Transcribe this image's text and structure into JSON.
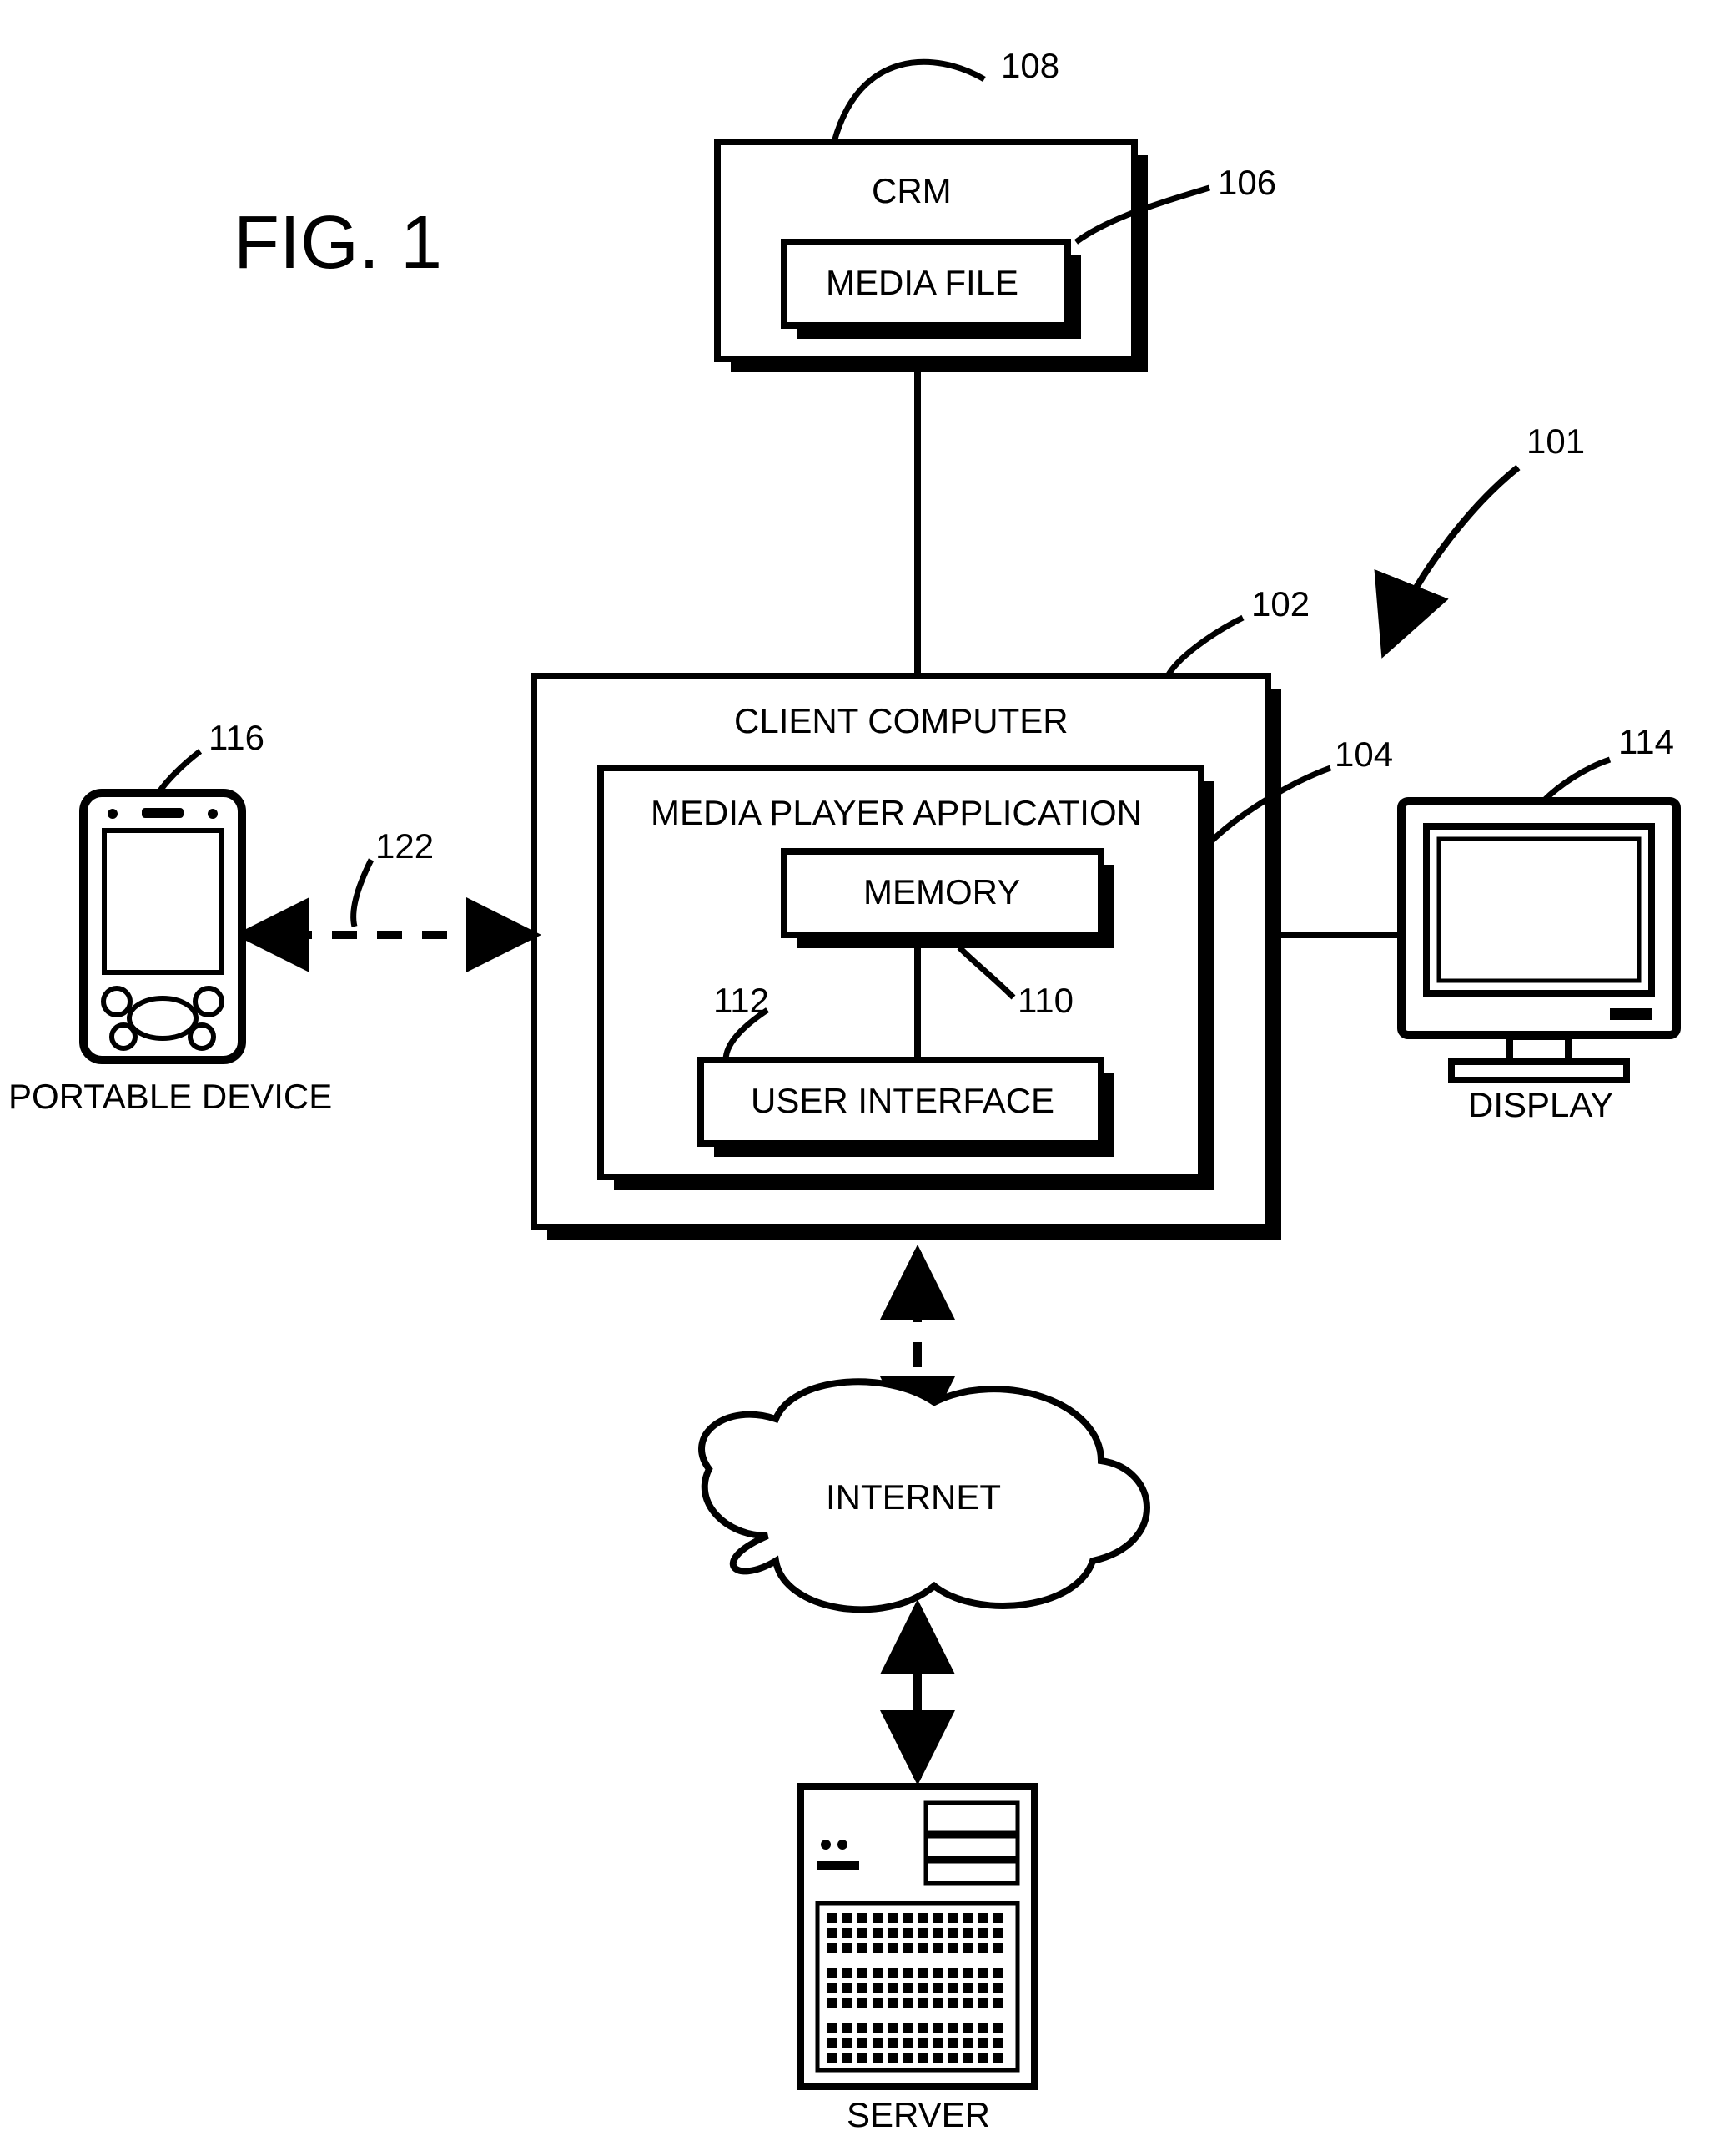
{
  "figure_title": "FIG. 1",
  "refs": {
    "r101": "101",
    "r102": "102",
    "r104": "104",
    "r106": "106",
    "r108": "108",
    "r110": "110",
    "r112": "112",
    "r114": "114",
    "r116": "116",
    "r122": "122"
  },
  "boxes": {
    "crm": "CRM",
    "media_file": "MEDIA FILE",
    "client_computer": "CLIENT COMPUTER",
    "media_player_app": "MEDIA PLAYER APPLICATION",
    "memory": "MEMORY",
    "user_interface": "USER INTERFACE"
  },
  "nodes": {
    "internet": "INTERNET",
    "server": "SERVER",
    "display": "DISPLAY",
    "portable_device": "PORTABLE DEVICE"
  }
}
